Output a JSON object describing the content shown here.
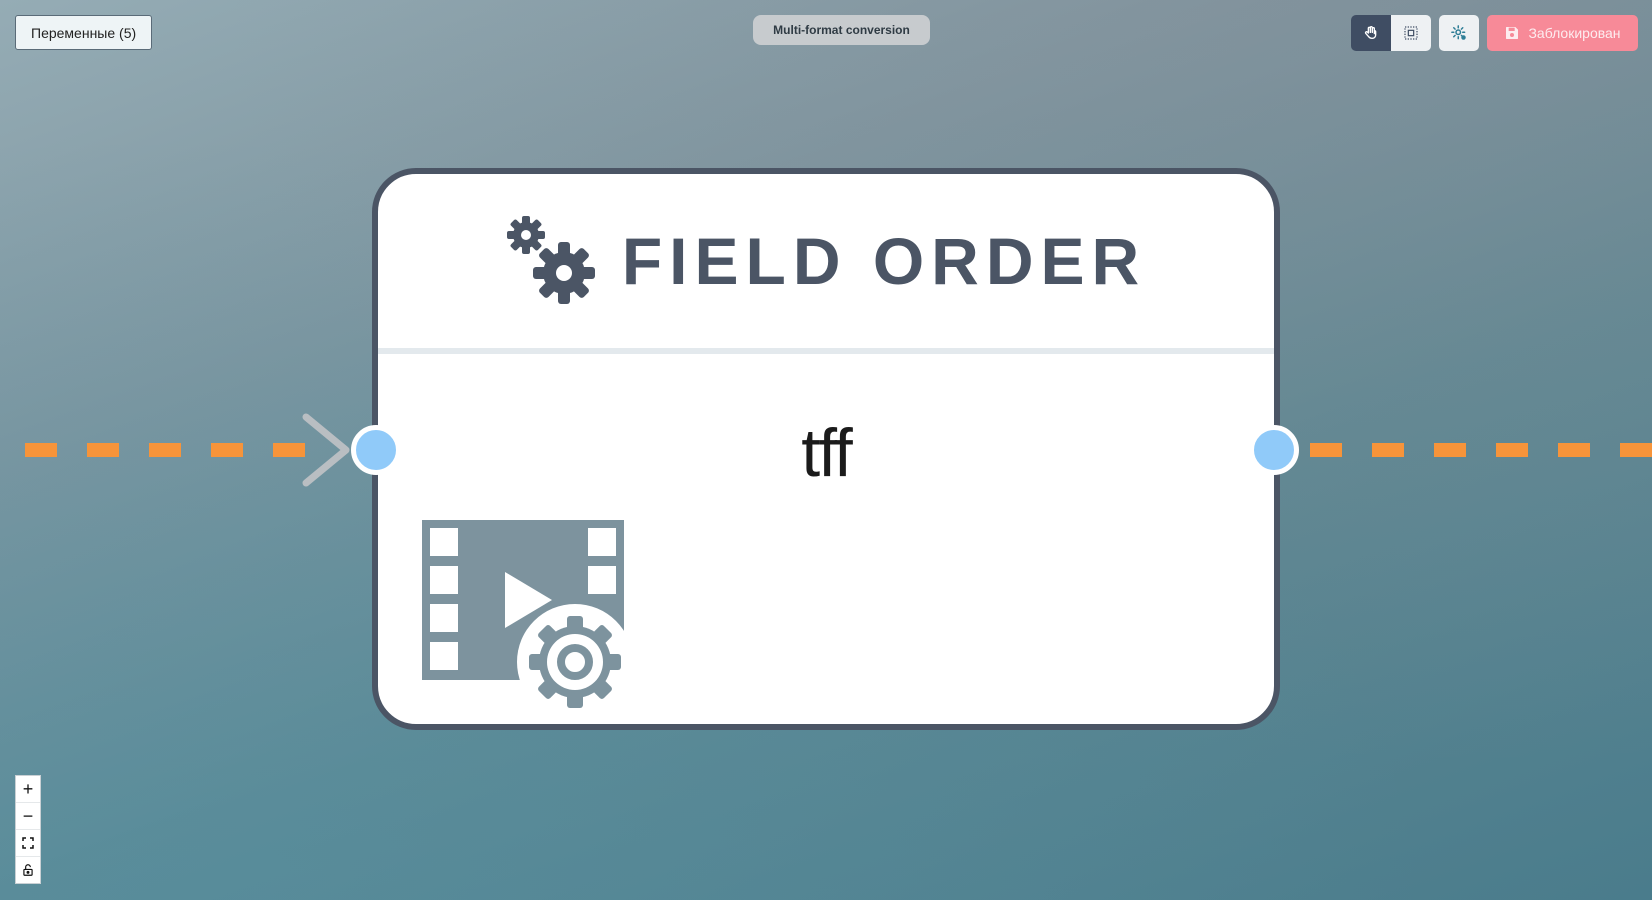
{
  "toolbar": {
    "variables_label": "Переменные (5)",
    "locked_label": "Заблокирован"
  },
  "flow": {
    "title": "Multi-format conversion"
  },
  "node": {
    "title": "FIELD ORDER",
    "value": "tff",
    "icon": "video-settings-icon",
    "header_icon": "gears-icon"
  },
  "zoom_controls": {
    "zoom_in": "+",
    "zoom_out": "−"
  },
  "colors": {
    "edge": "#f7943a",
    "handle": "#90caf9",
    "node_border": "#4b5565",
    "locked": "#f78a98",
    "mode_active": "#3f4d63"
  }
}
